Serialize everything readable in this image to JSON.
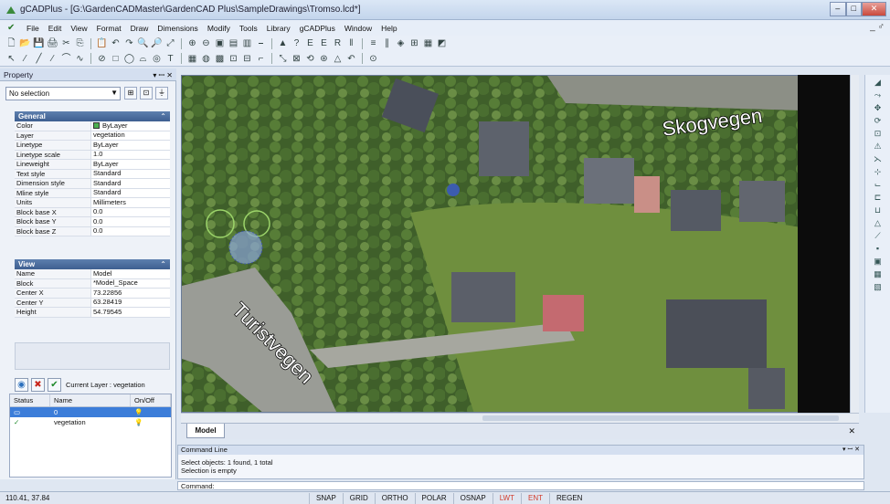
{
  "window": {
    "title": "gCADPlus - [G:\\GardenCADMaster\\GardenCAD Plus\\SampleDrawings\\Tromso.lcd*]",
    "min": "–",
    "max": "□",
    "close": "✕",
    "mdi_controls": "_ ♂"
  },
  "menu": [
    "File",
    "Edit",
    "View",
    "Format",
    "Draw",
    "Dimensions",
    "Modify",
    "Tools",
    "Library",
    "gCADPlus",
    "Window",
    "Help"
  ],
  "toolbar1": [
    "🗋",
    "📂",
    "💾",
    "🖨",
    "✂",
    "⎘",
    "📋",
    "↶",
    "↷",
    "🔍",
    "🔎",
    "⤢",
    "⊕",
    "⊖",
    "▣",
    "▤",
    "▥",
    "⎯",
    "▲",
    "?",
    "E",
    "E",
    "R",
    "‖",
    "≡",
    "∥",
    "◈",
    "⊞",
    "▦",
    "◩"
  ],
  "toolbar2": [
    "↖",
    "⁄",
    "╱",
    "∕",
    "⌒",
    "∿",
    "⊘",
    "□",
    "◯",
    "⌓",
    "◎",
    "T",
    "▦",
    "◍",
    "▩",
    "⊡",
    "⊟",
    "⌐",
    "⤡",
    "⊠",
    "⟲",
    "⊛",
    "△",
    "↶",
    "⊙"
  ],
  "property": {
    "panel_title": "Property",
    "controls": "▾ ꟷ ✕",
    "selection": "No selection",
    "general_title": "General",
    "general": [
      {
        "k": "Color",
        "v": "ByLayer",
        "swatch": "#4caf50"
      },
      {
        "k": "Layer",
        "v": "vegetation"
      },
      {
        "k": "Linetype",
        "v": "ByLayer"
      },
      {
        "k": "Linetype scale",
        "v": "1.0"
      },
      {
        "k": "Lineweight",
        "v": "ByLayer"
      },
      {
        "k": "Text style",
        "v": "Standard"
      },
      {
        "k": "Dimension style",
        "v": "Standard"
      },
      {
        "k": "Mline style",
        "v": "Standard"
      },
      {
        "k": "Units",
        "v": "Millimeters"
      },
      {
        "k": "Block base X",
        "v": "0.0"
      },
      {
        "k": "Block base Y",
        "v": "0.0"
      },
      {
        "k": "Block base Z",
        "v": "0.0"
      }
    ],
    "view_title": "View",
    "view": [
      {
        "k": "Name",
        "v": "Model"
      },
      {
        "k": "Block",
        "v": "*Model_Space"
      },
      {
        "k": "Center X",
        "v": "73.22856"
      },
      {
        "k": "Center Y",
        "v": "63.28419"
      },
      {
        "k": "Height",
        "v": "54.79545"
      }
    ],
    "collapse_glyph": "⌃"
  },
  "layers": {
    "current": "Current Layer : vegetation",
    "headers": {
      "status": "Status",
      "name": "Name",
      "onoff": "On/Off"
    },
    "rows": [
      {
        "status": "▭",
        "name": "0",
        "onoff": "💡"
      },
      {
        "status": "✓",
        "name": "vegetation",
        "onoff": "💡"
      }
    ]
  },
  "map": {
    "road1": "Skogvegen",
    "road2": "Turistvegen"
  },
  "tabs": {
    "model": "Model",
    "close": "✕"
  },
  "command": {
    "title": "Command Line",
    "controls": "▾ ꟷ ✕",
    "line1": "Select objects: 1 found,  1 total",
    "line2": "Selection is empty",
    "prompt": "Command:"
  },
  "status": {
    "coords": "110.41, 37.84",
    "buttons": [
      "SNAP",
      "GRID",
      "ORTHO",
      "POLAR",
      "OSNAP",
      "LWT",
      "ENT",
      "REGEN"
    ]
  },
  "right_toolbar": [
    "◢",
    "⤳",
    "✥",
    "⟳",
    "⊡",
    "⚠",
    "⋋",
    "⊹",
    "⌙",
    "⊏",
    "⊔",
    "△",
    "⟋",
    "▪",
    "▣",
    "▦",
    "▧"
  ]
}
